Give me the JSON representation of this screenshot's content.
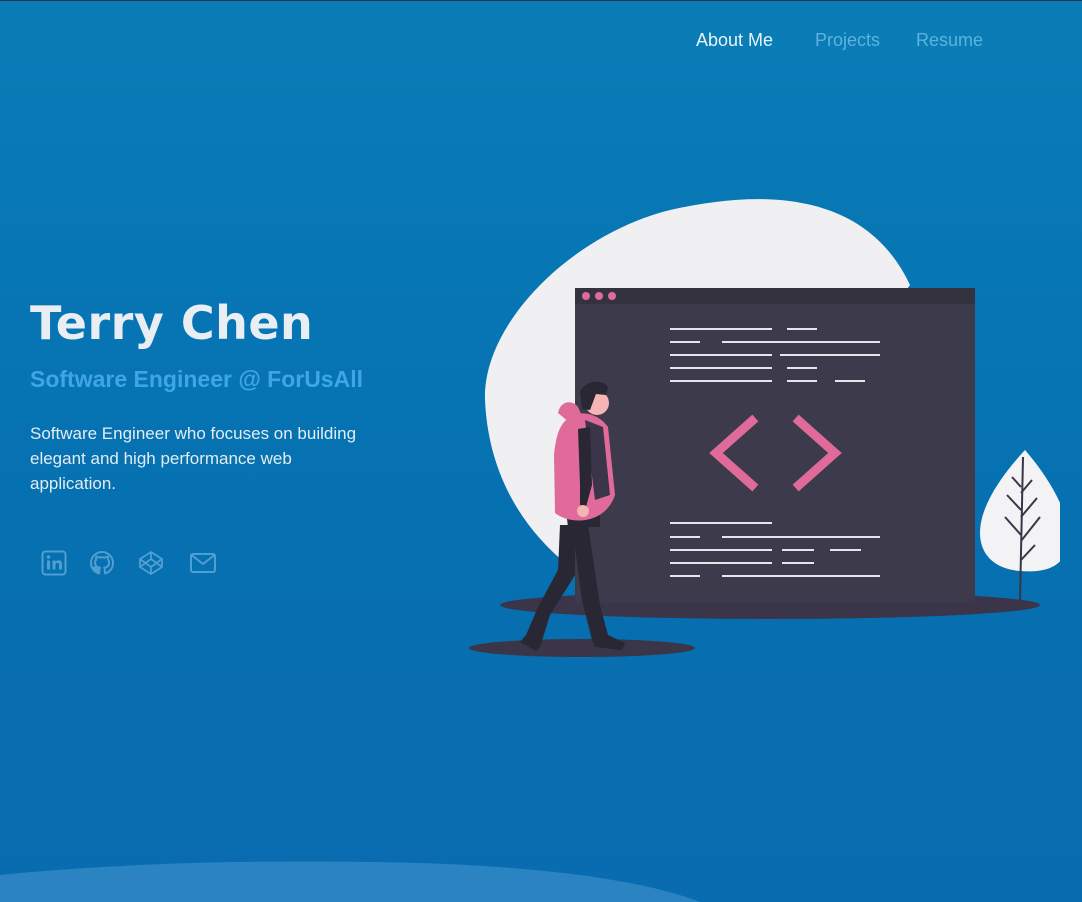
{
  "nav": {
    "items": [
      {
        "label": "About Me",
        "active": true
      },
      {
        "label": "Projects",
        "active": false
      },
      {
        "label": "Resume",
        "active": false
      }
    ]
  },
  "hero": {
    "name": "Terry Chen",
    "role": "Software Engineer @ ForUsAll",
    "description": "Software Engineer who focuses on building elegant and high performance web application."
  },
  "socials": [
    {
      "icon": "linkedin-icon"
    },
    {
      "icon": "github-icon"
    },
    {
      "icon": "codepen-icon"
    },
    {
      "icon": "mail-icon"
    }
  ],
  "colors": {
    "background": "#0776b4",
    "accent": "#3ea6e4",
    "nav_inactive": "#5fb2de",
    "illustration_pink": "#e06b9b",
    "illustration_dark": "#3a3548"
  }
}
